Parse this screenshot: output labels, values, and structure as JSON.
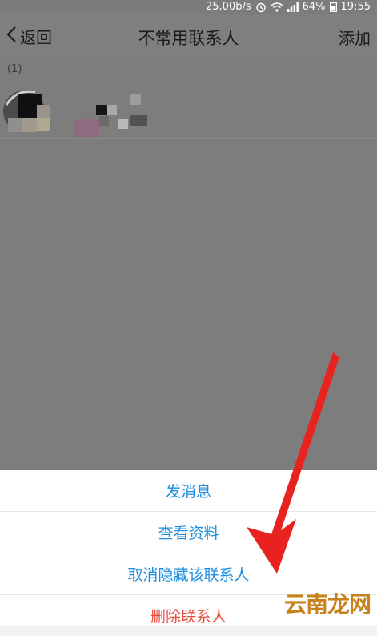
{
  "status_bar": {
    "speed": "25.00b/s",
    "battery": "64%",
    "time": "19:55"
  },
  "title_bar": {
    "back_label": "返回",
    "title": "不常用联系人",
    "add_label": "添加"
  },
  "contacts": {
    "group_header": "(1)"
  },
  "action_sheet": {
    "items": [
      {
        "label": "发消息"
      },
      {
        "label": "查看资料"
      },
      {
        "label": "取消隐藏该联系人"
      },
      {
        "label": "删除联系人"
      }
    ]
  },
  "watermark": "云南龙网",
  "colors": {
    "action_blue": "#1e8fe0",
    "action_red": "#e84e40",
    "dim_overlay": "#7d7d7d",
    "arrow_red": "#e8231f"
  }
}
